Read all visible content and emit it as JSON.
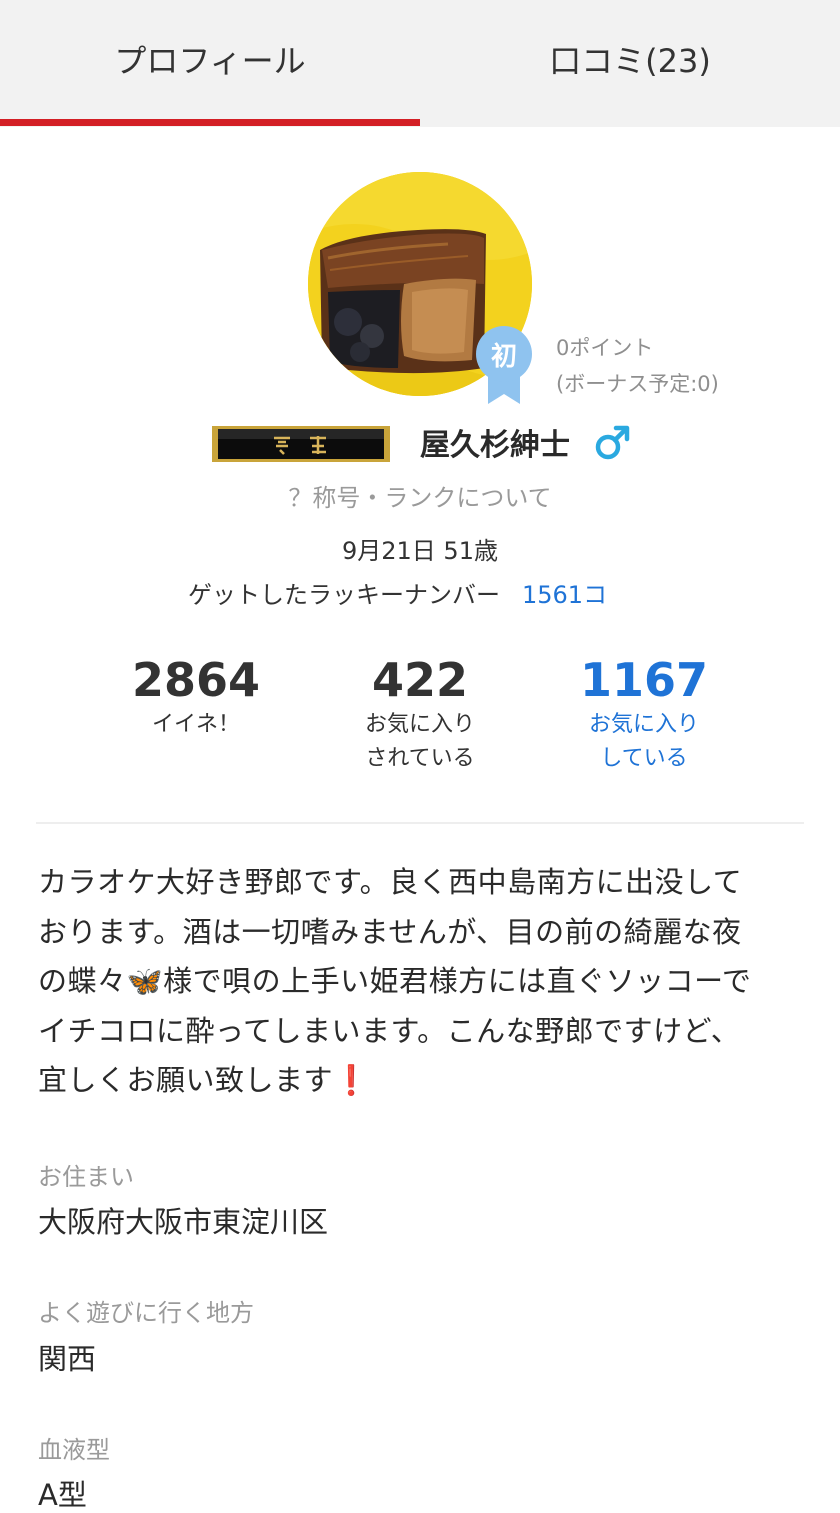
{
  "tabs": {
    "profile": "プロフィール",
    "reviews": "口コミ(23)"
  },
  "profile": {
    "avatar_icon": "profile-photo",
    "rank_badge": "初",
    "points_line1": "0ポイント",
    "points_line2": "(ボーナス予定:0)",
    "title_plate_icon": "title-plate-haja",
    "name": "屋久杉紳士",
    "gender_icon": "male-symbol",
    "rank_info_link": "？称号・ランクについて",
    "birthday_age": "9月21日 51歳",
    "lucky_label": "ゲットしたラッキーナンバー",
    "lucky_value": "1561コ"
  },
  "stats": {
    "likes": {
      "value": "2864",
      "label": "イイネ！"
    },
    "favorited": {
      "value": "422",
      "label1": "お気に入り",
      "label2": "されている"
    },
    "favoriting": {
      "value": "1167",
      "label1": "お気に入り",
      "label2": "している"
    }
  },
  "bio": {
    "line1": "カラオケ大好き野郎です。良く西中島南方に出没して",
    "line2": "おります。酒は一切嗜みませんが、目の前の綺麗な夜",
    "line3": "の蝶々🦋様で唄の上手い姫君様方には直ぐソッコーで",
    "line4": "イチコロに酔ってしまいます。こんな野郎ですけど、",
    "line5": "宜しくお願い致します❗"
  },
  "details": {
    "residence_label": "お住まい",
    "residence": "大阪府大阪市東淀川区",
    "area_label": "よく遊びに行く地方",
    "area": "関西",
    "blood_label": "血液型",
    "blood": "A型"
  },
  "colors": {
    "accent_red": "#d31f25",
    "link_blue": "#1f73d6",
    "badge_blue": "#8fc3ef",
    "gender_cyan": "#2aa9e0"
  }
}
